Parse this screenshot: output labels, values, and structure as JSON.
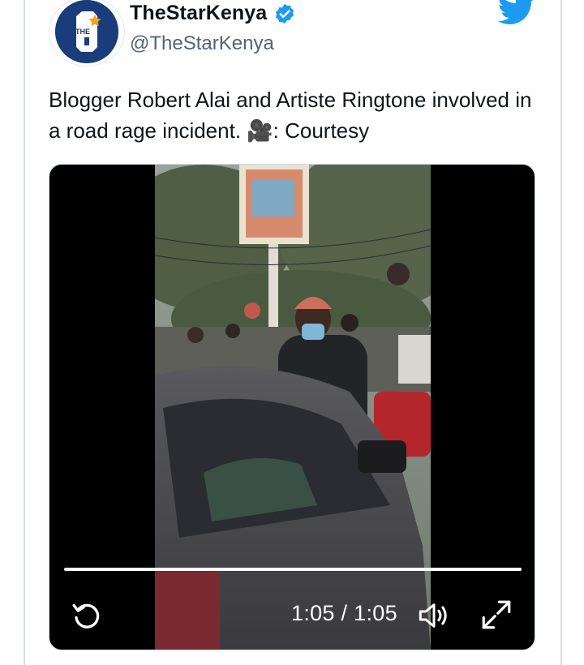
{
  "tweet": {
    "display_name": "TheStarKenya",
    "handle": "@TheStarKenya",
    "text": "Blogger Robert Alai and Artiste Ringtone involved in a road rage incident. 🎥: Courtesy",
    "avatar_letter": "S",
    "avatar_small_text": "THE"
  },
  "video": {
    "time_display": "1:05 / 1:05",
    "progress": 1.0
  },
  "colors": {
    "twitter_blue": "#1d9bf0",
    "avatar_navy": "#1b3c7a",
    "handle_gray": "#536471"
  },
  "icons": [
    "twitter-bird-icon",
    "verified-badge-icon",
    "replay-icon",
    "volume-icon",
    "fullscreen-icon"
  ]
}
